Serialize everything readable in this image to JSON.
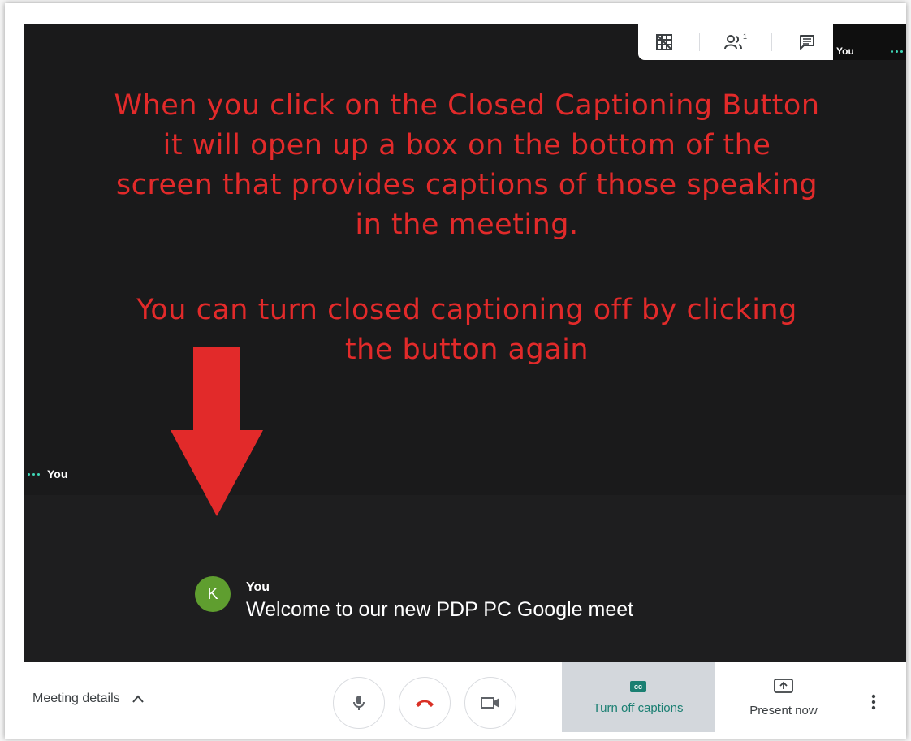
{
  "top_toolbar": {
    "icons": [
      "layout-grid-icon",
      "people-icon",
      "chat-icon"
    ],
    "participant_count": "1"
  },
  "self_tile": {
    "name": "You"
  },
  "main_video": {
    "name": "You"
  },
  "annotation": {
    "paragraph1": [
      "When you click on the Closed Captioning Button",
      "it will open up a box on the bottom of the",
      "screen that provides captions of those speaking",
      "in the meeting."
    ],
    "paragraph2": [
      "You can turn closed captioning off by clicking",
      "the button again"
    ],
    "color": "#e22a2a"
  },
  "caption": {
    "avatar_initial": "K",
    "speaker": "You",
    "text": "Welcome to our new PDP PC Google meet"
  },
  "bottom_bar": {
    "meeting_details_label": "Meeting details",
    "captions_label": "Turn off captions",
    "cc_badge": "CC",
    "present_label": "Present now"
  },
  "colors": {
    "accent_teal": "#1a7f72",
    "hangup_red": "#d93025",
    "avatar_green": "#5f9e2f"
  }
}
